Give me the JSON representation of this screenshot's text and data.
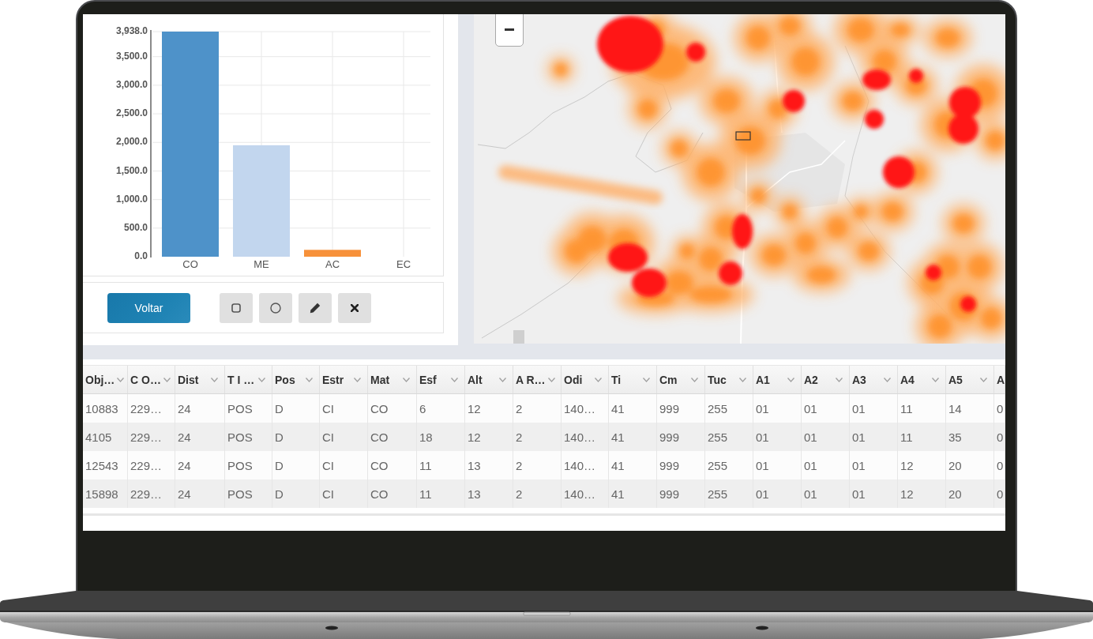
{
  "chart_panel": {
    "chart_data": {
      "type": "bar",
      "categories": [
        "CO",
        "ME",
        "AC",
        "EC"
      ],
      "values": [
        3938,
        1950,
        120,
        0
      ],
      "ylim": [
        0,
        3938
      ],
      "grid": true,
      "yticks": [
        {
          "value": 0,
          "label": "0.0"
        },
        {
          "value": 500,
          "label": "500.0"
        },
        {
          "value": 1000,
          "label": "1,000.0"
        },
        {
          "value": 1500,
          "label": "1,500.0"
        },
        {
          "value": 2000,
          "label": "2,000.0"
        },
        {
          "value": 2500,
          "label": "2,500.0"
        },
        {
          "value": 3000,
          "label": "3,000.0"
        },
        {
          "value": 3500,
          "label": "3,500.0"
        },
        {
          "value": 3938,
          "label": "3,938.0"
        }
      ]
    }
  },
  "toolbar": {
    "back_button": {
      "label": "Voltar"
    }
  },
  "table": {
    "columns": [
      "Obj…",
      "C O…",
      "Dist",
      "T I …",
      "Pos",
      "Estr",
      "Mat",
      "Esf",
      "Alt",
      "A R…",
      "Odi",
      "Ti",
      "Cm",
      "Tuc",
      "A1",
      "A2",
      "A3",
      "A4",
      "A5",
      "A"
    ],
    "rows": [
      [
        "10883",
        "229…",
        "24",
        "POS",
        "D",
        "CI",
        "CO",
        "6",
        "12",
        "2",
        "140…",
        "41",
        "999",
        "255",
        "01",
        "01",
        "01",
        "11",
        "14",
        "0"
      ],
      [
        "4105",
        "229…",
        "24",
        "POS",
        "D",
        "CI",
        "CO",
        "18",
        "12",
        "2",
        "140…",
        "41",
        "999",
        "255",
        "01",
        "01",
        "01",
        "11",
        "35",
        "0"
      ],
      [
        "12543",
        "229…",
        "24",
        "POS",
        "D",
        "CI",
        "CO",
        "11",
        "13",
        "2",
        "140…",
        "41",
        "999",
        "255",
        "01",
        "01",
        "01",
        "12",
        "20",
        "0"
      ],
      [
        "15898",
        "229…",
        "24",
        "POS",
        "D",
        "CI",
        "CO",
        "11",
        "13",
        "2",
        "140…",
        "41",
        "999",
        "255",
        "01",
        "01",
        "01",
        "12",
        "20",
        "0"
      ]
    ]
  }
}
